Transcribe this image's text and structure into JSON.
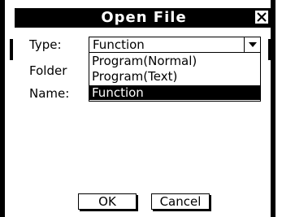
{
  "dialog": {
    "title": "Open File",
    "close_icon": "close-x-icon"
  },
  "form": {
    "type_label": "Type:",
    "folder_label": "Folder",
    "name_label": "Name:",
    "type_select": {
      "selected": "Function",
      "options": [
        "Program(Normal)",
        "Program(Text)",
        "Function"
      ],
      "highlighted_index": 2
    }
  },
  "buttons": {
    "ok": "OK",
    "cancel": "Cancel"
  }
}
